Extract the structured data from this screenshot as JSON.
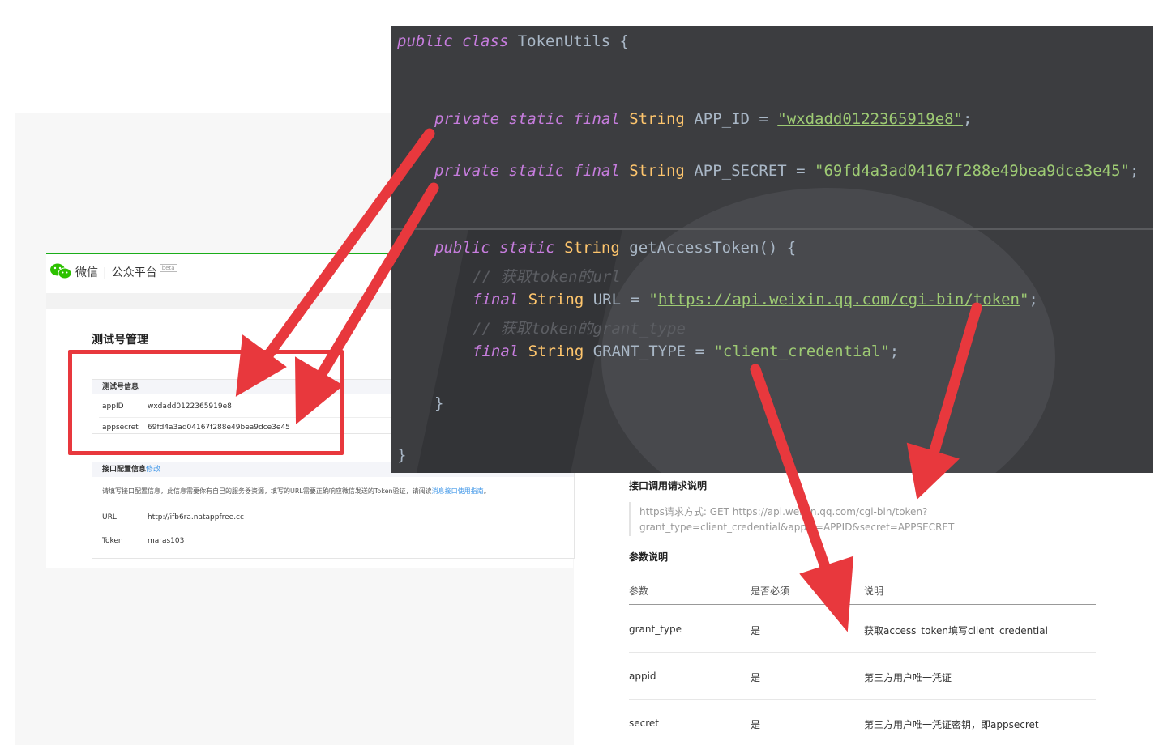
{
  "wechat": {
    "brand": "微信",
    "platform": "公众平台",
    "beta": "beta",
    "page_title": "测试号管理",
    "test_info": {
      "heading": "测试号信息",
      "appid_label": "appID",
      "appid_value": "wxdadd0122365919e8",
      "secret_label": "appsecret",
      "secret_value": "69fd4a3ad04167f288e49bea9dce3e45"
    },
    "config": {
      "heading": "接口配置信息",
      "edit_link": "修改",
      "hint": "请填写接口配置信息，此信息需要你有自己的服务器资源，填写的URL需要正确响应微信发送的Token验证，请阅读",
      "hint_link": "消息接口使用指南",
      "hint_end": "。",
      "url_label": "URL",
      "url_value": "http://ifb6ra.natappfree.cc",
      "token_label": "Token",
      "token_value": "maras103"
    }
  },
  "code": {
    "l1_kw": "public class",
    "l1_name": " TokenUtils {",
    "mod": "private static final",
    "type_string": "String",
    "app_id_name": " APP_ID = ",
    "app_id_value": "\"wxdadd0122365919e8\"",
    "app_secret_name": " APP_SECRET = ",
    "app_secret_value": "\"69fd4a3ad04167f288e49bea9dce3e45\"",
    "semicolon": ";",
    "method_kw": "public static",
    "method_sig": " getAccessToken() {",
    "comment_url": "// 获取token的url",
    "final_kw": "final",
    "url_name": " URL = ",
    "url_q": "\"",
    "url_value": "https://api.weixin.qq.com/cgi-bin/token",
    "comment_grant": "// 获取token的grant_type",
    "grant_name": " GRANT_TYPE = ",
    "grant_value": "\"client_credential\"",
    "close_inner": "}",
    "close_outer": "}"
  },
  "doc": {
    "request_heading": "接口调用请求说明",
    "request_line1": "https请求方式: GET https://api.weixin.qq.com/cgi-bin/token?",
    "request_line2": "grant_type=client_credential&appid=APPID&secret=APPSECRET",
    "params_heading": "参数说明",
    "columns": [
      "参数",
      "是否必须",
      "说明"
    ],
    "rows": [
      {
        "param": "grant_type",
        "required": "是",
        "desc": "获取access_token填写client_credential"
      },
      {
        "param": "appid",
        "required": "是",
        "desc": "第三方用户唯一凭证"
      },
      {
        "param": "secret",
        "required": "是",
        "desc": "第三方用户唯一凭证密钥，即appsecret"
      }
    ]
  },
  "colors": {
    "annotation_red": "#e8383d",
    "wechat_green": "#1aad19",
    "editor_bg": "#3c3d40"
  }
}
